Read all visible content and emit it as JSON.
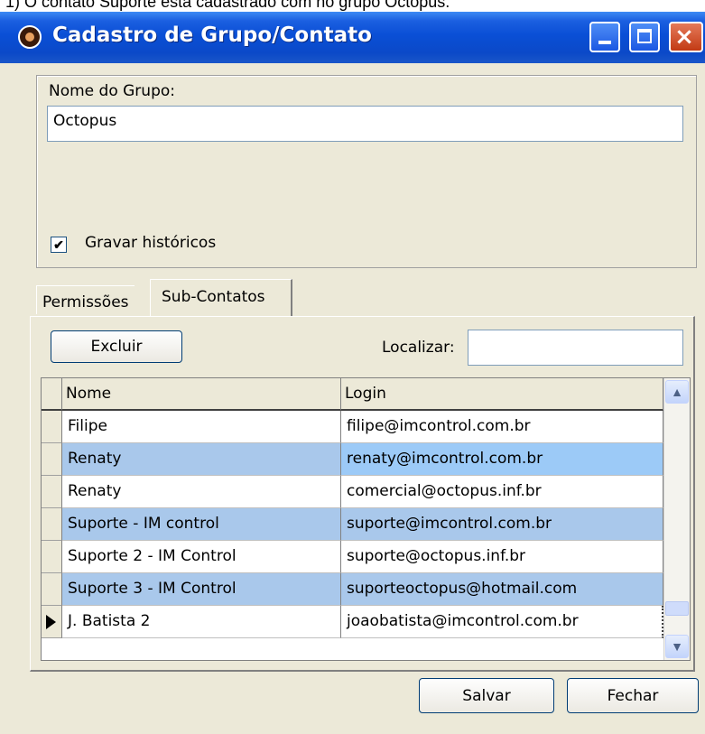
{
  "background_text": "1) O contato Suporte está cadastrado com no grupo Octopus.",
  "window": {
    "title": "Cadastro de Grupo/Contato",
    "icon": "octopus-app-icon"
  },
  "group_panel": {
    "name_label": "Nome do Grupo:",
    "name_value": "Octopus",
    "save_history_label": "Gravar históricos",
    "save_history_checked": true
  },
  "tabs": [
    {
      "label": "Permissões",
      "active": false
    },
    {
      "label": "Sub-Contatos",
      "active": true
    }
  ],
  "subcontacts": {
    "delete_button": "Excluir",
    "search_label": "Localizar:",
    "search_value": "",
    "columns": [
      "Nome",
      "Login"
    ],
    "rows": [
      {
        "name": "Filipe",
        "login": "filipe@imcontrol.com.br"
      },
      {
        "name": "Renaty",
        "login": "renaty@imcontrol.com.br"
      },
      {
        "name": "Renaty",
        "login": "comercial@octopus.inf.br"
      },
      {
        "name": "Suporte - IM control",
        "login": "suporte@imcontrol.com.br"
      },
      {
        "name": "Suporte 2 - IM Control",
        "login": "suporte@octopus.inf.br"
      },
      {
        "name": "Suporte 3 - IM Control",
        "login": "suporteoctopus@hotmail.com"
      },
      {
        "name": "J. Batista 2",
        "login": "joaobatista@imcontrol.com.br"
      }
    ],
    "current_row": 6
  },
  "footer": {
    "save_button": "Salvar",
    "close_button": "Fechar"
  },
  "colors": {
    "titlebar": "#0a4fd6",
    "window_bg": "#ece9d8",
    "alt_row": "#a9c8eb",
    "selected_cell": "#9ccaf7"
  }
}
